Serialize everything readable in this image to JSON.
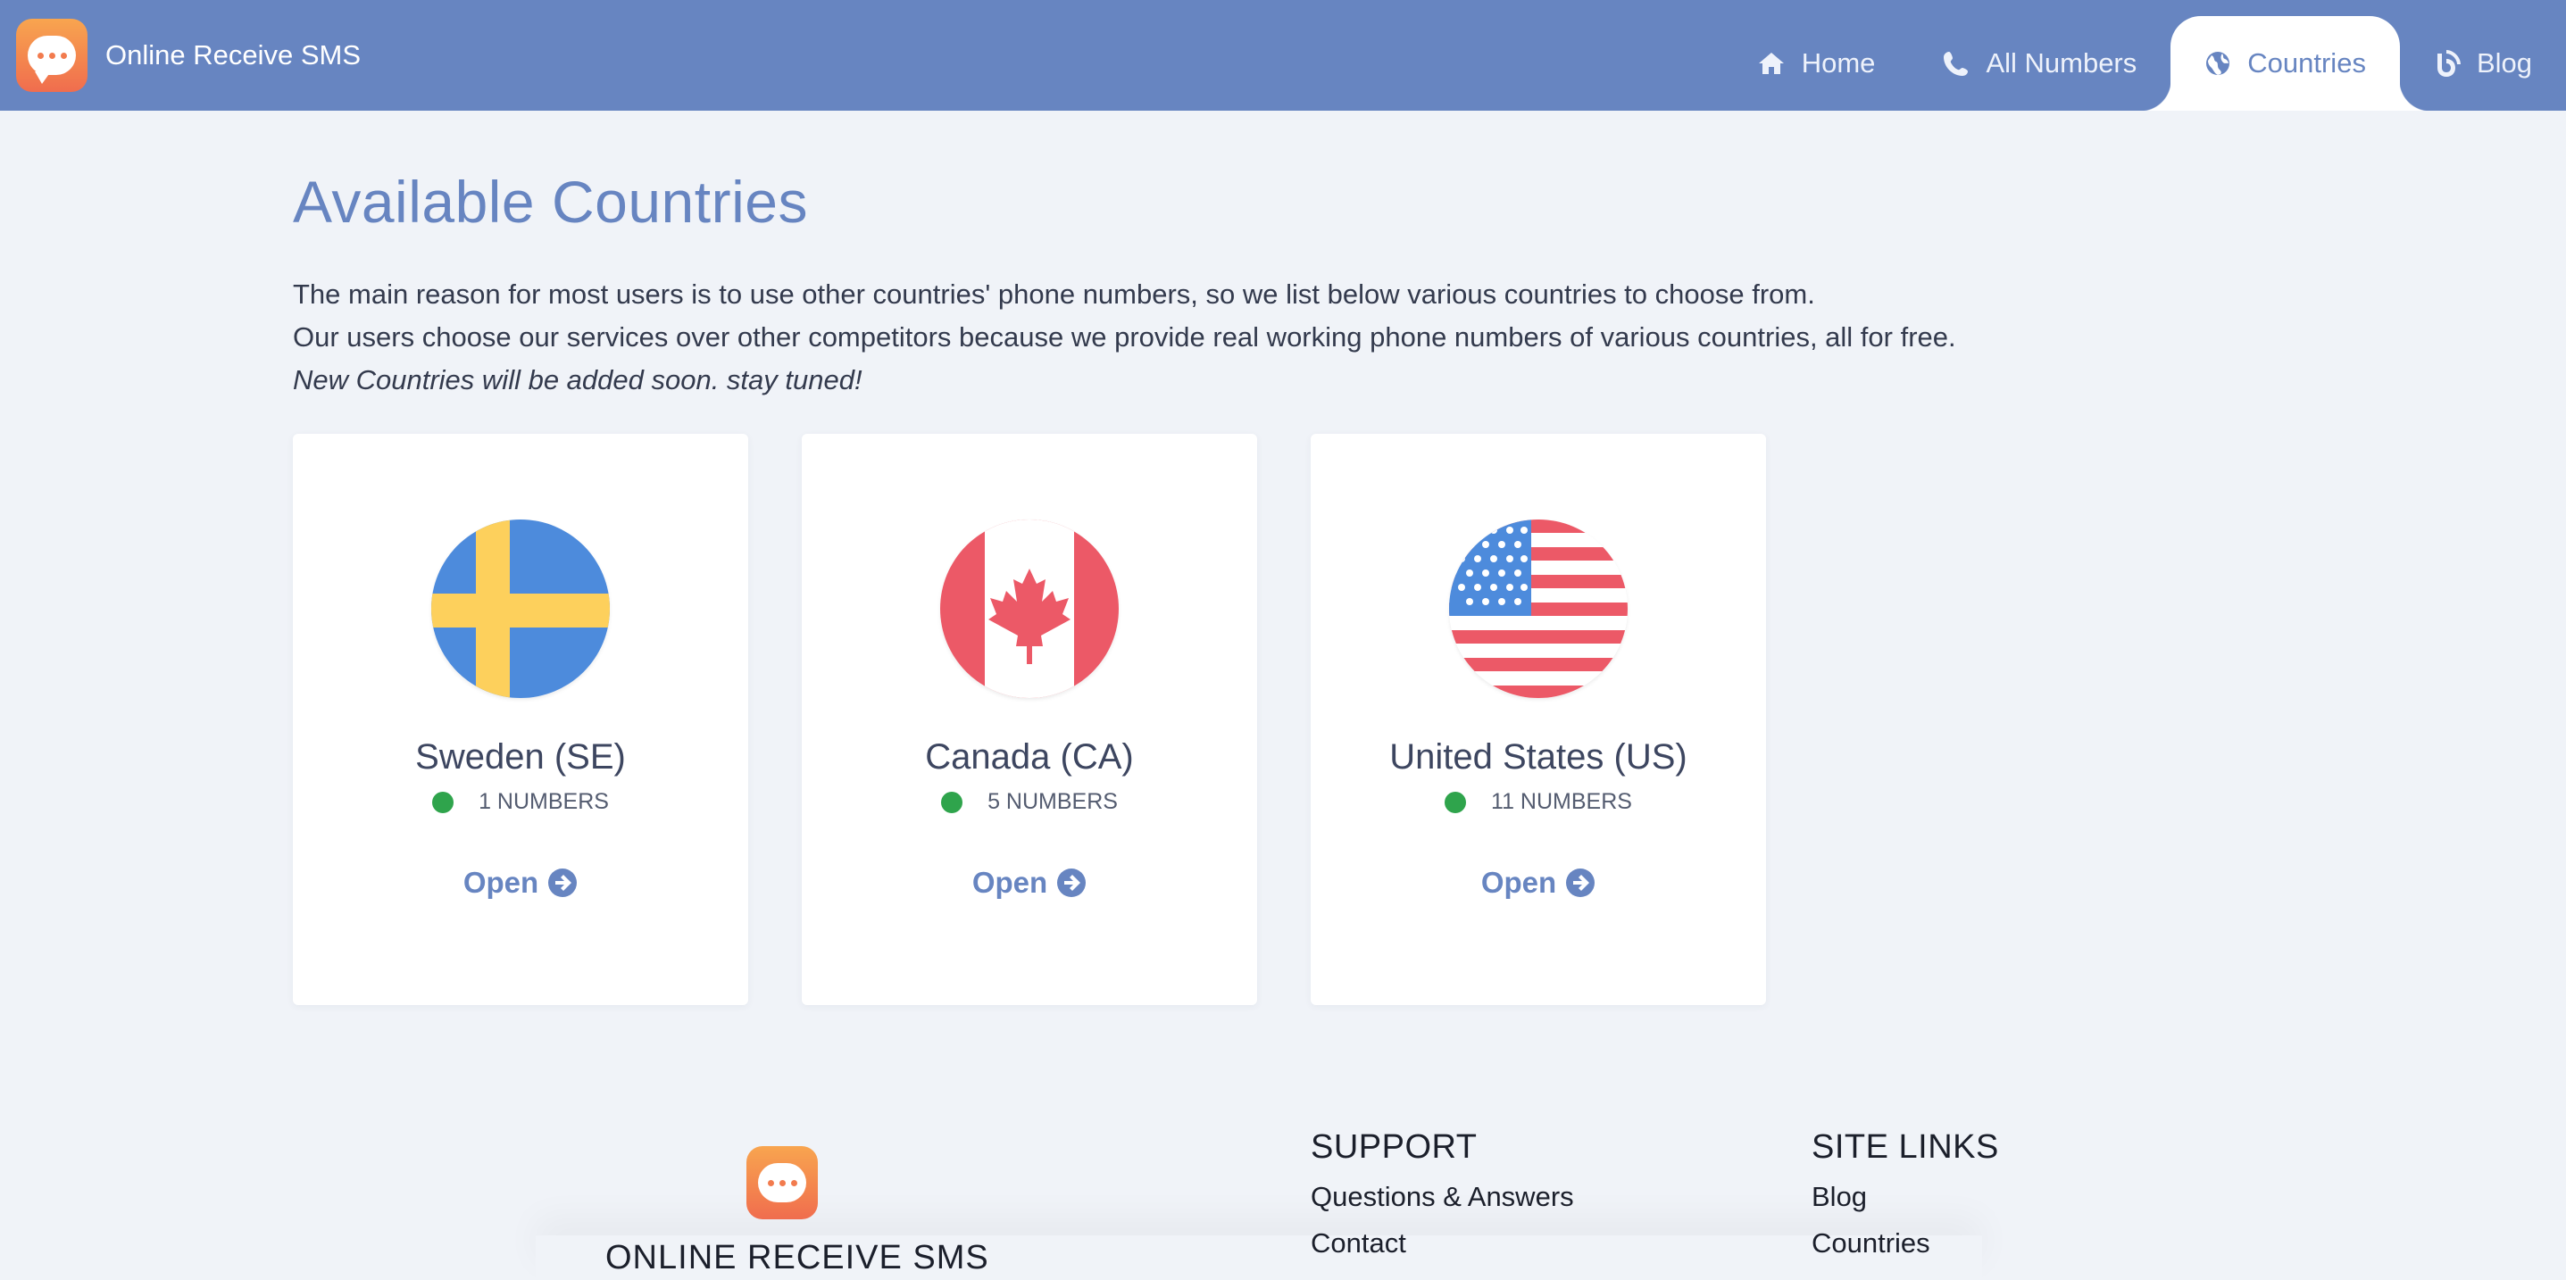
{
  "header": {
    "brand_name": "Online Receive SMS",
    "nav": [
      {
        "label": "Home",
        "icon": "home-icon"
      },
      {
        "label": "All Numbers",
        "icon": "phone-icon"
      },
      {
        "label": "Countries",
        "icon": "globe-icon",
        "active": true
      },
      {
        "label": "Blog",
        "icon": "blog-icon"
      }
    ]
  },
  "main": {
    "title": "Available Countries",
    "intro_line1": "The main reason for most users is to use other countries' phone numbers, so we list below various countries to choose from.",
    "intro_line2": "Our users choose our services over other competitors because we provide real working phone numbers of various countries, all for free.",
    "intro_line3": "New Countries will be added soon. stay tuned!",
    "countries": [
      {
        "name": "Sweden (SE)",
        "numbers": "1 NUMBERS",
        "open": "Open",
        "flag": "sweden-flag-icon"
      },
      {
        "name": "Canada (CA)",
        "numbers": "5 NUMBERS",
        "open": "Open",
        "flag": "canada-flag-icon"
      },
      {
        "name": "United States (US)",
        "numbers": "11 NUMBERS",
        "open": "Open",
        "flag": "us-flag-icon"
      }
    ]
  },
  "footer": {
    "brand": "ONLINE RECEIVE SMS",
    "support_title": "SUPPORT",
    "support_links": [
      "Questions & Answers",
      "Contact"
    ],
    "site_title": "SITE LINKS",
    "site_links": [
      "Blog",
      "Countries"
    ]
  },
  "colors": {
    "accent": "#6785c1",
    "background": "#f0f3f8",
    "status_active": "#2fa44c",
    "logo_gradient_start": "#f8a54f",
    "logo_gradient_end": "#f06d4e"
  }
}
